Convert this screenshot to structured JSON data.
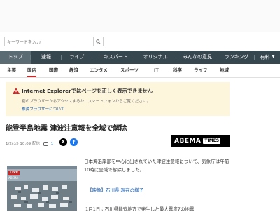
{
  "search": {
    "placeholder": "キーワードを入力"
  },
  "nav_primary": {
    "items": [
      {
        "label": "トップ",
        "active": true
      },
      {
        "label": "速報"
      },
      {
        "label": "ライブ"
      },
      {
        "label": "エキスパート"
      },
      {
        "label": "オリジナル"
      },
      {
        "label": "みんなの意見"
      },
      {
        "label": "ランキング"
      },
      {
        "label": "有料"
      }
    ]
  },
  "nav_secondary": {
    "items": [
      {
        "label": "主要"
      },
      {
        "label": "国内",
        "active": true
      },
      {
        "label": "国際"
      },
      {
        "label": "経済"
      },
      {
        "label": "エンタメ"
      },
      {
        "label": "スポーツ"
      },
      {
        "label": "IT"
      },
      {
        "label": "科学"
      },
      {
        "label": "ライフ"
      },
      {
        "label": "地域"
      }
    ]
  },
  "notice": {
    "title": "Internet Explorerではページを正しく表示できません",
    "sub": "別のブラウザーからアクセスするか、スマートフォンからご覧ください。",
    "link": "推奨ブラウザーについて"
  },
  "article": {
    "headline": "能登半島地震 津波注意報を全域で解除",
    "meta_date": "1/2(火) 10:09 配信",
    "comment_count": "1",
    "share_x": "X",
    "share_fb": "f",
    "publisher_logo": "ABEMA",
    "publisher_logo_suffix": "TIMES",
    "body1": "日本海沿岸部を中心に出されていた津波注意報について、気象庁は午前10時に全域で解除しました。",
    "caption": "【映像】石川県 現在の様子",
    "body2": "1月1日に石川県能登地方で発生した最大震度7の地震"
  },
  "thumbnail": {
    "badge": "LIVE",
    "badge_sub": "ABEMA"
  },
  "colors": {
    "nav_bg": "#37474f",
    "nav_active_bg": "#5b6b73",
    "accent_red": "#c62828",
    "notice_bg": "#fdf5dc",
    "link_blue": "#1a5fb4"
  }
}
